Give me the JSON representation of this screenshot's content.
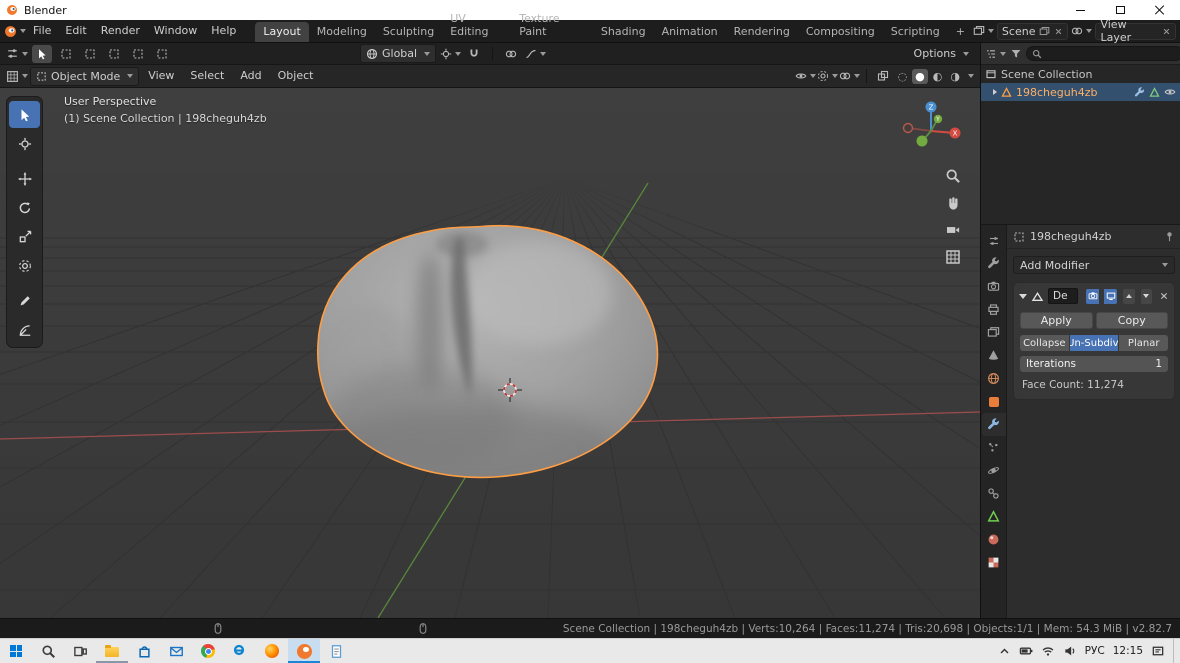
{
  "titlebar": {
    "title": "Blender"
  },
  "topbar": {
    "menus": [
      "File",
      "Edit",
      "Render",
      "Window",
      "Help"
    ],
    "workspaces": [
      "Layout",
      "Modeling",
      "Sculpting",
      "UV Editing",
      "Texture Paint",
      "Shading",
      "Animation",
      "Rendering",
      "Compositing",
      "Scripting"
    ],
    "add_workspace": "+",
    "scene_name": "Scene",
    "view_layer_name": "View Layer"
  },
  "tool_settings": {
    "orientation": "Global",
    "options": "Options"
  },
  "viewport_header": {
    "mode": "Object Mode",
    "menus": [
      "View",
      "Select",
      "Add",
      "Object"
    ]
  },
  "viewport": {
    "perspective_label": "User Perspective",
    "context_label": "(1) Scene Collection | 198cheguh4zb",
    "axis_x": "X",
    "axis_y": "Y",
    "axis_z": "Z"
  },
  "outliner": {
    "scene_collection": "Scene Collection",
    "object_name": "198cheguh4zb"
  },
  "properties": {
    "breadcrumb_object": "198cheguh4zb",
    "add_modifier": "Add Modifier",
    "modifier": {
      "name": "De",
      "apply": "Apply",
      "copy": "Copy",
      "modes": [
        "Collapse",
        "Un-Subdiv.",
        "Planar"
      ],
      "iterations_label": "Iterations",
      "iterations_value": "1",
      "face_count": "Face Count: 11,274"
    }
  },
  "status_bar": {
    "stats": "Scene Collection | 198cheguh4zb | Verts:10,264 | Faces:11,274 | Tris:20,698 | Objects:1/1 | Mem: 54.3 MiB | v2.82.7"
  },
  "taskbar": {
    "language": "РУС",
    "time": "12:15"
  }
}
